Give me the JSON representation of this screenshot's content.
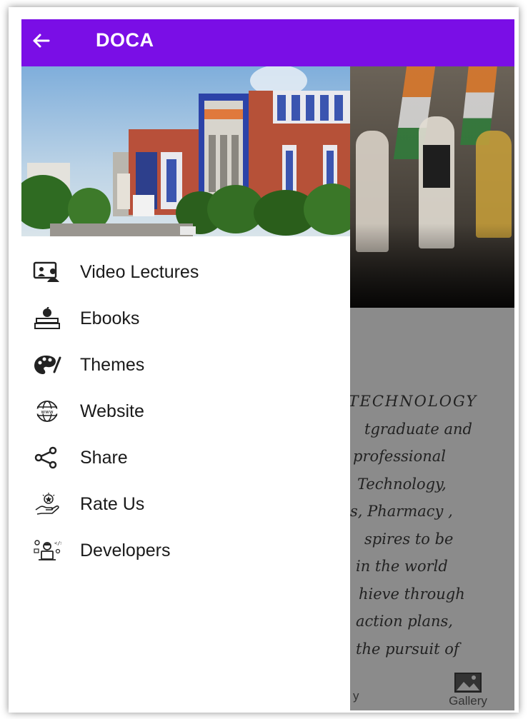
{
  "app_bar": {
    "title": "DOCA",
    "background": "#7a0ee6"
  },
  "drawer": {
    "items": [
      {
        "label": "Video Lectures",
        "icon": "video-lecture-icon"
      },
      {
        "label": "Ebooks",
        "icon": "ebooks-icon"
      },
      {
        "label": "Themes",
        "icon": "palette-icon"
      },
      {
        "label": "Website",
        "icon": "globe-www-icon"
      },
      {
        "label": "Share",
        "icon": "share-icon"
      },
      {
        "label": "Rate Us",
        "icon": "rate-us-icon"
      },
      {
        "label": "Developers",
        "icon": "developers-icon"
      }
    ]
  },
  "background_content": {
    "text_lines": [
      "D TECHNOLOGY",
      "tgraduate and",
      "professional",
      "Technology,",
      "s, Pharmacy ,",
      "spires to be",
      "in the world",
      "hieve through",
      "action plans,",
      "the pursuit of"
    ],
    "bottom_nav": {
      "gallery_label": "Gallery",
      "partial_label": "y"
    }
  }
}
